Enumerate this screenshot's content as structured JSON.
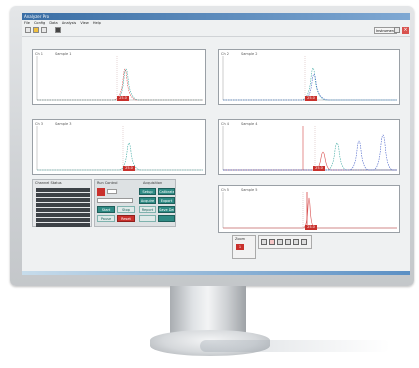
{
  "window": {
    "title": "Analyzer Pro"
  },
  "menu": [
    "File",
    "Config",
    "Data",
    "Analysis",
    "View",
    "Help"
  ],
  "toolbar": {
    "right_button": "Instrument"
  },
  "plots": [
    {
      "id": "p1",
      "label": "Ch 1",
      "title": "Sample 1",
      "marker": "25.0"
    },
    {
      "id": "p2",
      "label": "Ch 2",
      "title": "Sample 2",
      "marker": "25.0"
    },
    {
      "id": "p3",
      "label": "Ch 3",
      "title": "Sample 3",
      "marker": "25.0"
    },
    {
      "id": "p4",
      "label": "Ch 4",
      "title": "Sample 4",
      "marker": "25.0"
    },
    {
      "id": "p5",
      "label": "Ch 5",
      "title": "Sample 5",
      "marker": "25.0"
    }
  ],
  "channels_panel": {
    "title": "Channel Status",
    "rows": [
      "1",
      "2",
      "3",
      "4",
      "5",
      "6",
      "7",
      "8"
    ]
  },
  "control_panel": {
    "left_title": "Run Control",
    "right_title": "Acquisition",
    "buttons_left": [
      "Start",
      "Stop",
      "Pause",
      "Reset"
    ],
    "buttons_right": [
      "Setup",
      "Calibrate",
      "Acquire",
      "Export",
      "Report",
      "Save Data"
    ]
  },
  "bottom_controls": {
    "label": "Zoom",
    "value": "1"
  },
  "colors": {
    "accent": "#2f8a84",
    "alert": "#c9302c",
    "trace_red": "#d64545",
    "trace_teal": "#3aa7a0",
    "trace_blue": "#4a63c9"
  }
}
